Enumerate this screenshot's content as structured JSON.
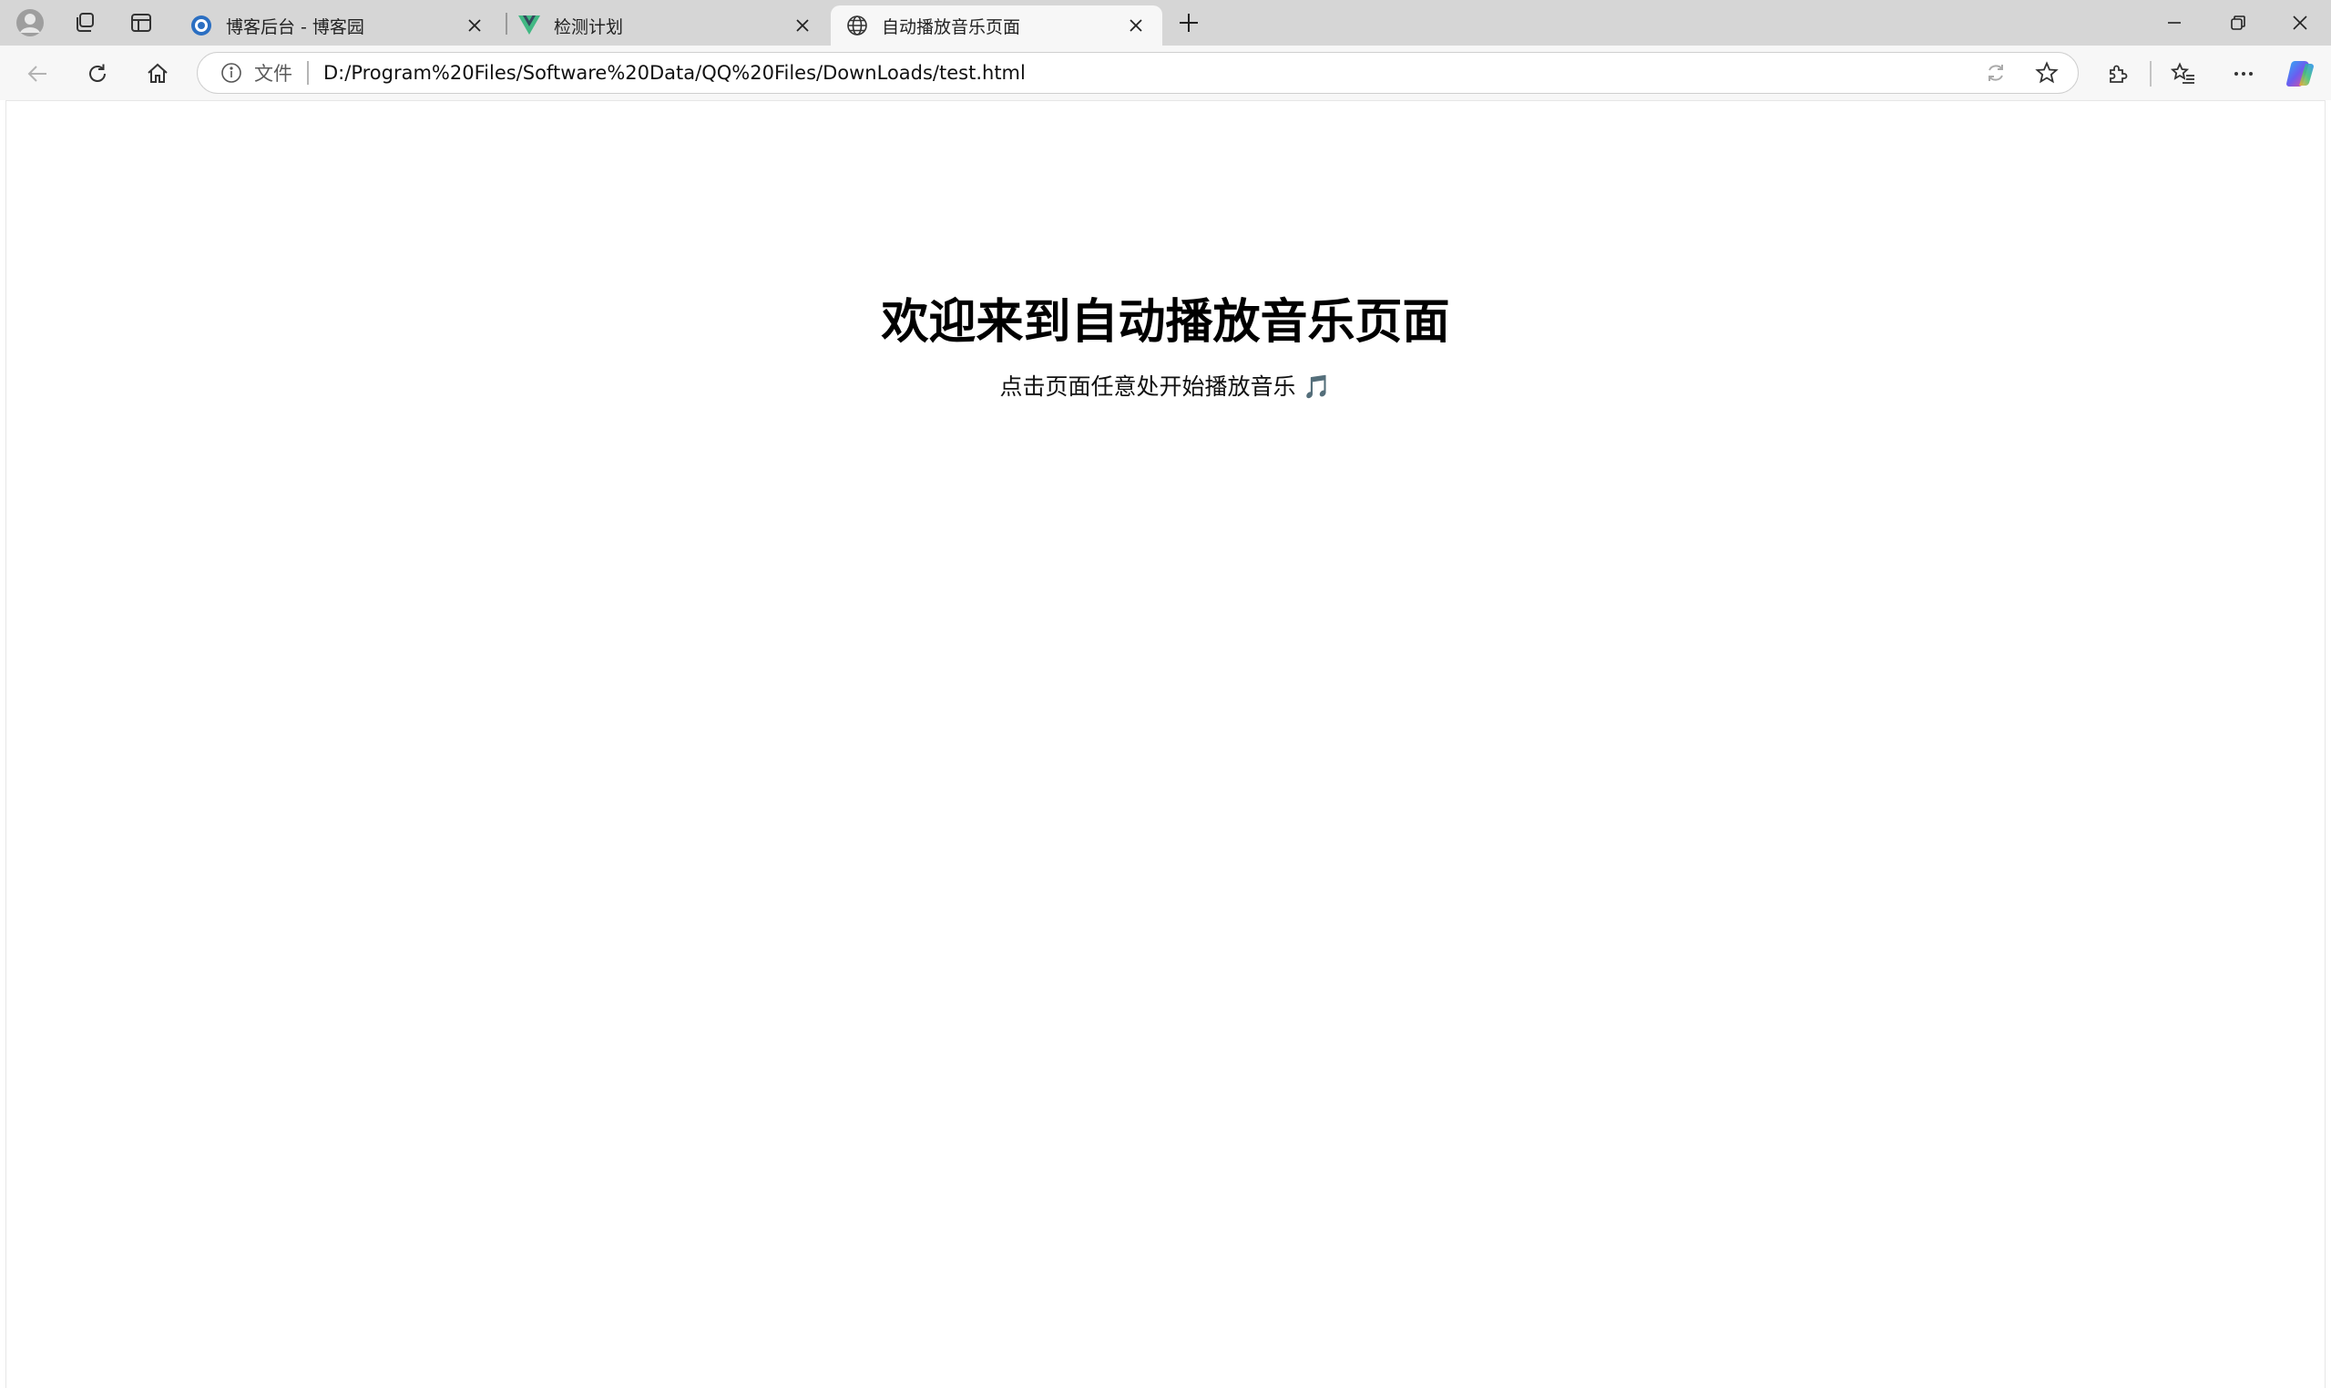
{
  "browser": {
    "tabs": [
      {
        "label": "博客后台 - 博客园",
        "favicon": "cnblogs-icon",
        "active": false
      },
      {
        "label": "检测计划",
        "favicon": "vue-icon",
        "active": false
      },
      {
        "label": "自动播放音乐页面",
        "favicon": "globe-icon",
        "active": true
      }
    ],
    "address": {
      "chip": "文件",
      "url": "D:/Program%20Files/Software%20Data/QQ%20Files/DownLoads/test.html"
    },
    "colors": {
      "titlebar": "#d6d6d6",
      "toolbar": "#f7f7f7",
      "active_tab": "#f7f7f7"
    }
  },
  "page": {
    "title": "欢迎来到自动播放音乐页面",
    "subtitle": "点击页面任意处开始播放音乐 🎵"
  }
}
